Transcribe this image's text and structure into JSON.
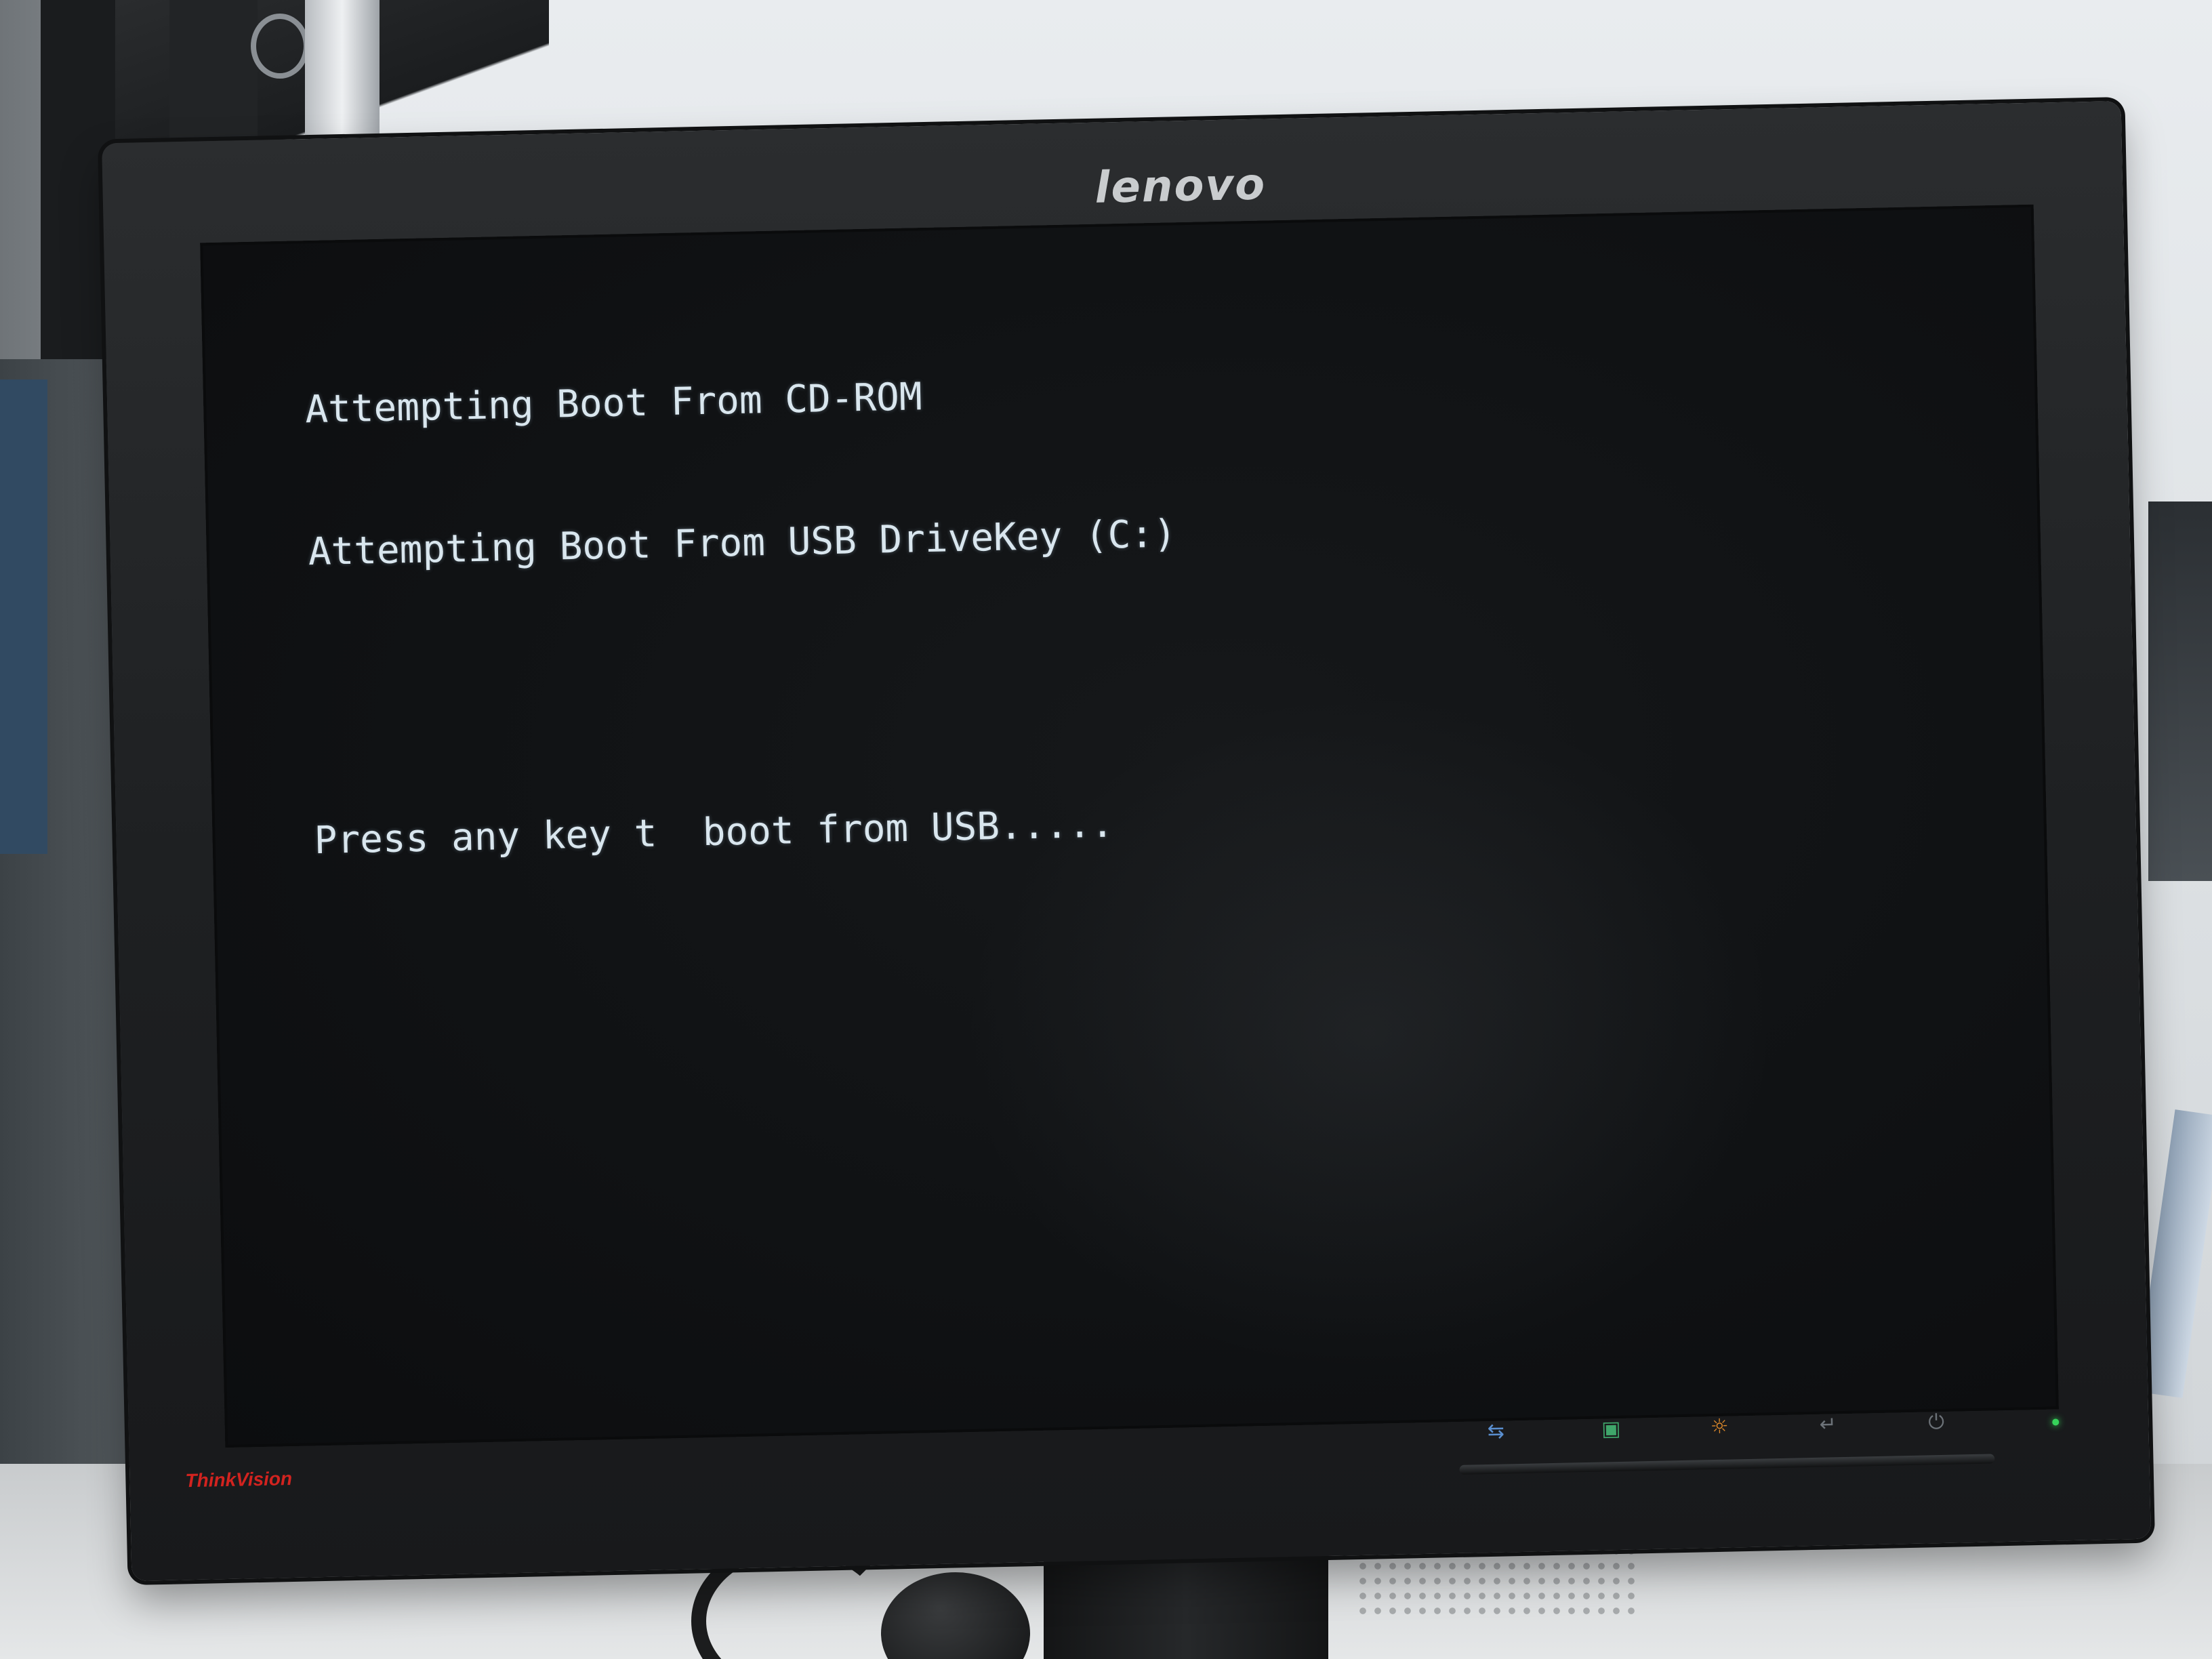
{
  "monitor": {
    "brand": "lenovo",
    "model_badge": "ThinkVision",
    "colors": {
      "bezel": "#1e2022",
      "screen": "#101214",
      "text": "#d9e6ee",
      "badge": "#d2231f",
      "power_led": "#36d35a"
    },
    "controls": [
      {
        "name": "input-select",
        "icon": "input-switch-icon",
        "glyph": "⇆"
      },
      {
        "name": "image-setup",
        "icon": "image-setup-icon",
        "glyph": "▣"
      },
      {
        "name": "brightness",
        "icon": "brightness-icon",
        "glyph": "☼"
      },
      {
        "name": "enter",
        "icon": "enter-icon",
        "glyph": "↵"
      },
      {
        "name": "power",
        "icon": "power-icon",
        "glyph": "⏻"
      }
    ]
  },
  "boot_screen": {
    "lines": [
      "Attempting Boot From CD-ROM",
      "Attempting Boot From USB DriveKey (C:)",
      "Press any key t  boot from USB....."
    ]
  }
}
